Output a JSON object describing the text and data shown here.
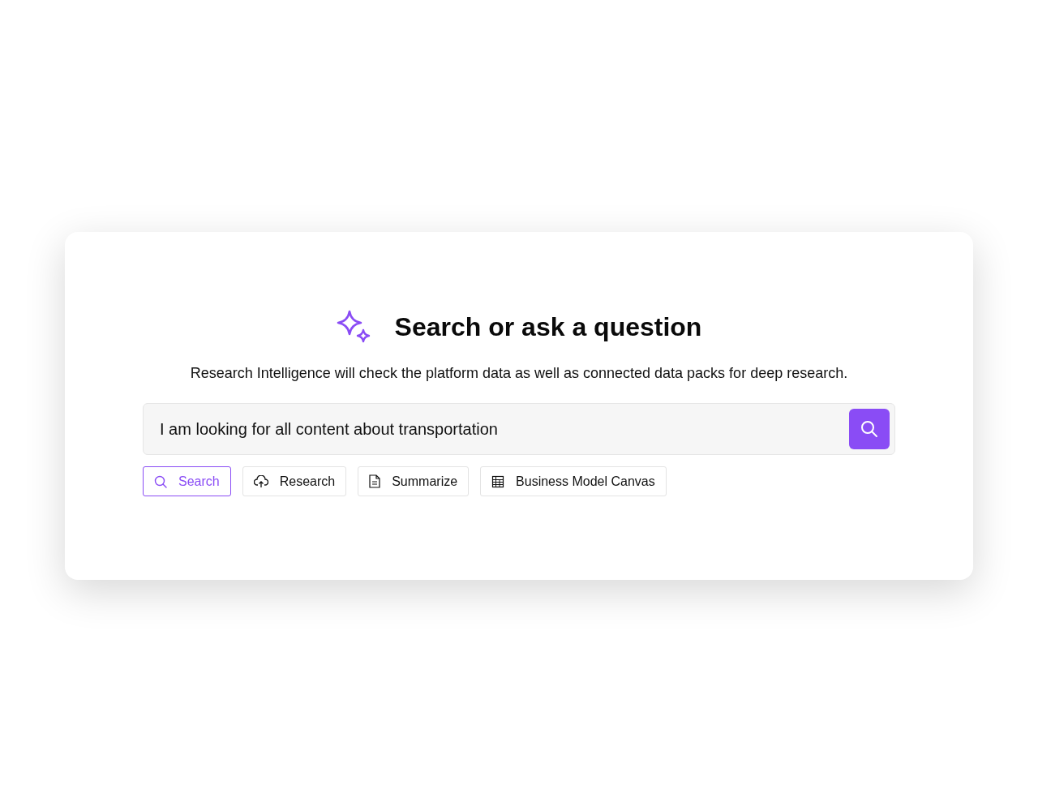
{
  "title": "Search or ask a question",
  "description": "Research Intelligence will check the platform data as well as connected data packs for deep research.",
  "query": {
    "value": "I am looking for all content about transportation"
  },
  "modes": [
    {
      "label": "Search",
      "kind": "search",
      "selected": true
    },
    {
      "label": "Research",
      "kind": "research",
      "selected": false
    },
    {
      "label": "Summarize",
      "kind": "summarize",
      "selected": false
    },
    {
      "label": "Business Model Canvas",
      "kind": "canvas",
      "selected": false
    }
  ]
}
